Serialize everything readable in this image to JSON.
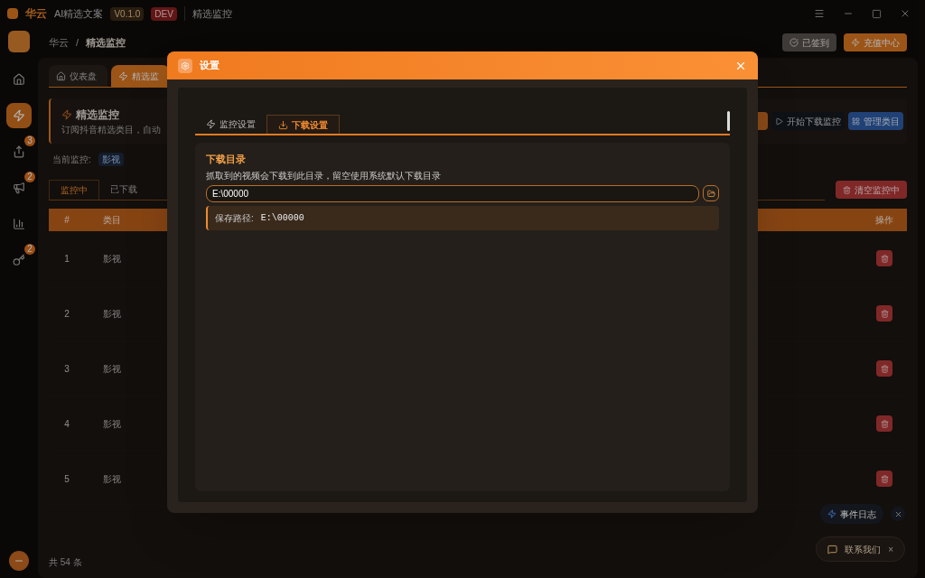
{
  "titlebar": {
    "brand": "华云",
    "app": "AI精选文案",
    "version": "V0.1.0",
    "env": "DEV",
    "page": "精选监控"
  },
  "sidebar": {
    "items": [
      {
        "kind": "home",
        "selected": false
      },
      {
        "kind": "bolt",
        "selected": true
      },
      {
        "kind": "share",
        "selected": false,
        "badge": "3"
      },
      {
        "kind": "speaker",
        "selected": false,
        "badge": "2"
      },
      {
        "kind": "chart",
        "selected": false
      },
      {
        "kind": "key",
        "selected": false,
        "badge": "2"
      }
    ]
  },
  "breadcrumb": {
    "root": "华云",
    "separator": "/",
    "current": "精选监控"
  },
  "header_buttons": [
    {
      "kind": "checkin",
      "label": "已签到"
    },
    {
      "kind": "recharge",
      "label": "充值中心"
    }
  ],
  "page_tabs": [
    {
      "label": "仪表盘",
      "kind": "home",
      "selected": false
    },
    {
      "label": "精选监",
      "kind": "bolt",
      "selected": true
    }
  ],
  "page": {
    "title": "精选监控",
    "subtitle": "订阅抖音精选类目，自动",
    "actions": [
      {
        "kind": "start",
        "label": "开始下载监控"
      },
      {
        "kind": "manage",
        "label": "管理类目"
      }
    ],
    "current_label": "当前监控:",
    "current_tag": "影视"
  },
  "list_tabs": [
    {
      "label": "监控中",
      "selected": true
    },
    {
      "label": "已下载",
      "selected": false
    }
  ],
  "clear_button": "清空监控中",
  "table": {
    "columns": [
      "#",
      "类目",
      "操作"
    ],
    "rows": [
      {
        "index": "1",
        "category": "影视"
      },
      {
        "index": "2",
        "category": "影视"
      },
      {
        "index": "3",
        "category": "影视"
      },
      {
        "index": "4",
        "category": "影视"
      },
      {
        "index": "5",
        "category": "影视"
      }
    ]
  },
  "footer": "共 54 条",
  "event_log": "事件日志",
  "contact": {
    "label": "联系我们",
    "close": "×"
  },
  "dialog": {
    "title": "设置",
    "tabs": [
      {
        "label": "监控设置",
        "kind": "bolt",
        "selected": false
      },
      {
        "label": "下载设置",
        "kind": "download",
        "selected": true
      }
    ],
    "section_title": "下载目录",
    "description": "抓取到的视频会下载到此目录，留空使用系统默认下载目录",
    "path_value": "E:\\00000",
    "save_label": "保存路径:",
    "save_value": "E:\\00000"
  }
}
